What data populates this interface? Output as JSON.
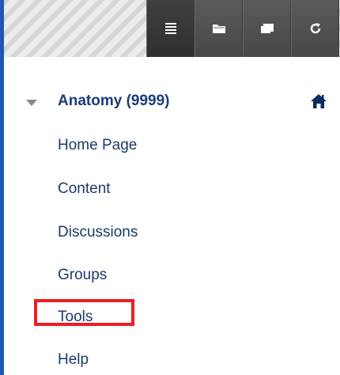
{
  "toolbar": {
    "buttons": [
      {
        "icon": "list-icon",
        "active": true
      },
      {
        "icon": "folder-icon",
        "active": false
      },
      {
        "icon": "window-icon",
        "active": false
      },
      {
        "icon": "refresh-icon",
        "active": false
      }
    ]
  },
  "course": {
    "title": "Anatomy (9999)"
  },
  "nav": {
    "items": [
      {
        "label": "Home Page"
      },
      {
        "label": "Content"
      },
      {
        "label": "Discussions"
      },
      {
        "label": "Groups"
      },
      {
        "label": "Tools"
      },
      {
        "label": "Help"
      }
    ],
    "highlighted": "Tools"
  },
  "colors": {
    "link": "#1c3a6e",
    "highlight": "#ee1c24",
    "frame": "#1f57b5"
  }
}
